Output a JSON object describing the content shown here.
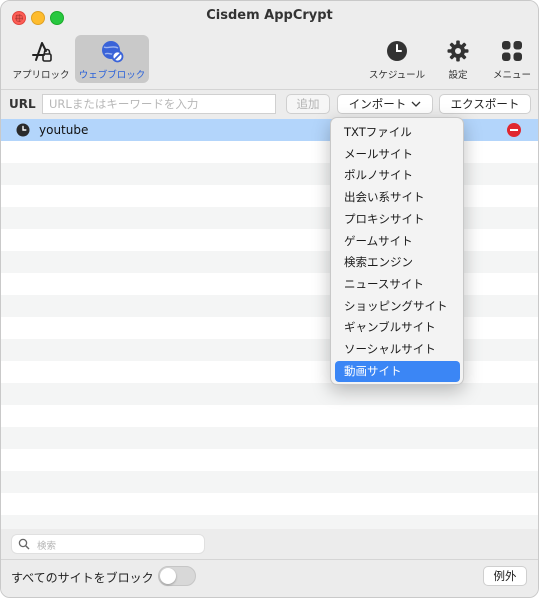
{
  "window": {
    "title": "Cisdem AppCrypt"
  },
  "toolbar": {
    "app_lock": "アプリロック",
    "web_block": "ウェブブロック",
    "schedule": "スケジュール",
    "settings": "設定",
    "menu": "メニュー"
  },
  "urlbar": {
    "label": "URL",
    "placeholder": "URLまたはキーワードを入力",
    "add": "追加",
    "import": "インポート",
    "export": "エクスポート"
  },
  "list": {
    "items": [
      {
        "label": "youtube",
        "selected": true
      }
    ]
  },
  "import_menu": {
    "items": [
      "TXTファイル",
      "メールサイト",
      "ポルノサイト",
      "出会い系サイト",
      "プロキシサイト",
      "ゲームサイト",
      "検索エンジン",
      "ニュースサイト",
      "ショッピングサイト",
      "ギャンブルサイト",
      "ソーシャルサイト",
      "動画サイト"
    ],
    "highlighted": "動画サイト"
  },
  "bottom": {
    "search_placeholder": "検索",
    "block_all_label": "すべてのサイトをブロック",
    "block_all_on": false,
    "exceptions": "例外"
  },
  "colors": {
    "accent": "#3b86f5",
    "selection": "#b3d5fb",
    "remove": "#e0272f",
    "web_block_icon": "#3a63d8"
  }
}
